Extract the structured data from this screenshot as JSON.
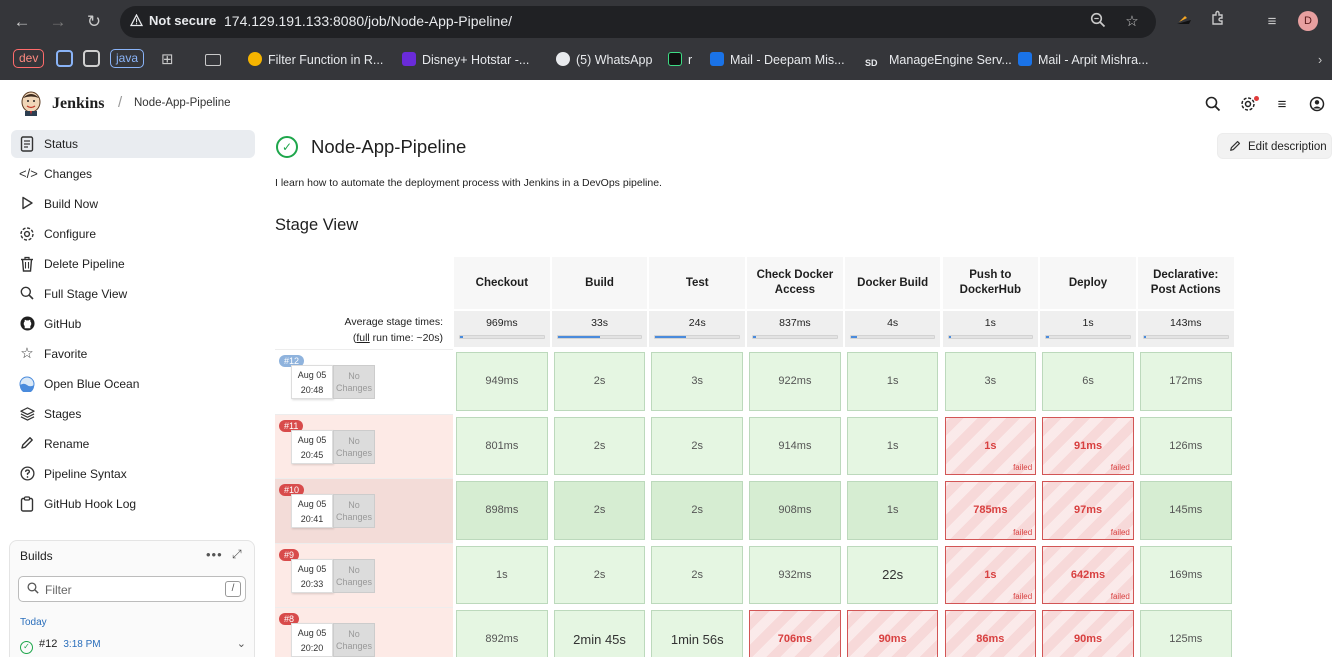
{
  "browser": {
    "security_label": "Not secure",
    "url": "174.129.191.133:8080/job/Node-App-Pipeline/",
    "profile_initial": "D",
    "bookmarks": [
      {
        "label": "dev"
      },
      {
        "label": "java"
      },
      {
        "label": "Filter Function in R..."
      },
      {
        "label": "Disney+ Hotstar -..."
      },
      {
        "label": "(5) WhatsApp"
      },
      {
        "label": "r"
      },
      {
        "label": "Mail - Deepam Mis..."
      },
      {
        "label": "ManageEngine Serv..."
      },
      {
        "label": "Mail - Arpit Mishra..."
      }
    ]
  },
  "header": {
    "app_title": "Jenkins",
    "separator": "/",
    "breadcrumb": "Node-App-Pipeline"
  },
  "sidebar": {
    "items": [
      {
        "label": "Status",
        "icon": "document-icon"
      },
      {
        "label": "Changes",
        "icon": "code-icon"
      },
      {
        "label": "Build Now",
        "icon": "play-icon"
      },
      {
        "label": "Configure",
        "icon": "gear-icon"
      },
      {
        "label": "Delete Pipeline",
        "icon": "trash-icon"
      },
      {
        "label": "Full Stage View",
        "icon": "search-icon"
      },
      {
        "label": "GitHub",
        "icon": "github-icon"
      },
      {
        "label": "Favorite",
        "icon": "star-icon"
      },
      {
        "label": "Open Blue Ocean",
        "icon": "blue-ocean-icon"
      },
      {
        "label": "Stages",
        "icon": "layers-icon"
      },
      {
        "label": "Rename",
        "icon": "pencil-icon"
      },
      {
        "label": "Pipeline Syntax",
        "icon": "help-icon"
      },
      {
        "label": "GitHub Hook Log",
        "icon": "clipboard-icon"
      }
    ],
    "builds": {
      "title": "Builds",
      "more": "•••",
      "filter_placeholder": "Filter",
      "filter_shortcut": "/",
      "group_label": "Today",
      "build_number": "#12",
      "build_time": "3:18 PM"
    }
  },
  "main": {
    "title": "Node-App-Pipeline",
    "edit_label": "Edit description",
    "description": "I learn how to automate the deployment process with Jenkins in a DevOps pipeline.",
    "stage_view_title": "Stage View",
    "avg_label": "Average stage times:",
    "full_prefix": "(",
    "full_link": "full",
    "full_suffix": " run time: ~20s)",
    "stages": [
      "Checkout",
      "Build",
      "Test",
      "Check Docker\nAccess",
      "Docker Build",
      "Push to\nDockerHub",
      "Deploy",
      "Declarative:\nPost Actions"
    ],
    "averages": [
      {
        "label": "969ms",
        "fill": 0.03
      },
      {
        "label": "33s",
        "fill": 0.5
      },
      {
        "label": "24s",
        "fill": 0.37
      },
      {
        "label": "837ms",
        "fill": 0.03
      },
      {
        "label": "4s",
        "fill": 0.08
      },
      {
        "label": "1s",
        "fill": 0.03
      },
      {
        "label": "1s",
        "fill": 0.03
      },
      {
        "label": "143ms",
        "fill": 0.01
      }
    ],
    "failed_label": "failed",
    "no_changes": "No\nChanges",
    "runs": [
      {
        "number": "#12",
        "status": "success",
        "date": "Aug 05",
        "time": "20:48",
        "cells": [
          [
            "949ms",
            "ok"
          ],
          [
            "2s",
            "ok"
          ],
          [
            "3s",
            "ok"
          ],
          [
            "922ms",
            "ok"
          ],
          [
            "1s",
            "ok"
          ],
          [
            "3s",
            "ok"
          ],
          [
            "6s",
            "ok"
          ],
          [
            "172ms",
            "ok"
          ]
        ]
      },
      {
        "number": "#11",
        "status": "failed",
        "date": "Aug 05",
        "time": "20:45",
        "cells": [
          [
            "801ms",
            "ok"
          ],
          [
            "2s",
            "ok"
          ],
          [
            "2s",
            "ok"
          ],
          [
            "914ms",
            "ok"
          ],
          [
            "1s",
            "ok"
          ],
          [
            "1s",
            "fail"
          ],
          [
            "91ms",
            "fail"
          ],
          [
            "126ms",
            "ok"
          ]
        ]
      },
      {
        "number": "#10",
        "status": "failed",
        "date": "Aug 05",
        "time": "20:41",
        "cells": [
          [
            "898ms",
            "ok"
          ],
          [
            "2s",
            "ok"
          ],
          [
            "2s",
            "ok"
          ],
          [
            "908ms",
            "ok"
          ],
          [
            "1s",
            "ok"
          ],
          [
            "785ms",
            "fail"
          ],
          [
            "97ms",
            "fail"
          ],
          [
            "145ms",
            "ok"
          ]
        ]
      },
      {
        "number": "#9",
        "status": "failed",
        "date": "Aug 05",
        "time": "20:33",
        "cells": [
          [
            "1s",
            "ok"
          ],
          [
            "2s",
            "ok"
          ],
          [
            "2s",
            "ok"
          ],
          [
            "932ms",
            "ok"
          ],
          [
            "22s",
            "ok"
          ],
          [
            "1s",
            "fail"
          ],
          [
            "642ms",
            "fail"
          ],
          [
            "169ms",
            "ok"
          ]
        ]
      },
      {
        "number": "#8",
        "status": "failed",
        "date": "Aug 05",
        "time": "20:20",
        "cells": [
          [
            "892ms",
            "ok"
          ],
          [
            "2min 45s",
            "ok"
          ],
          [
            "1min 56s",
            "ok"
          ],
          [
            "706ms",
            "fail"
          ],
          [
            "90ms",
            "fail"
          ],
          [
            "86ms",
            "fail"
          ],
          [
            "90ms",
            "fail"
          ],
          [
            "125ms",
            "ok"
          ]
        ]
      }
    ]
  },
  "colors": {
    "success_green": "#1ea64b",
    "fail_red": "#d84040",
    "row_fail_bg": "#fdeae6",
    "row_fail_hover_bg": "#f3dcd8",
    "cell_ok": "#e5f6e2",
    "bar_blue": "#4a8bdc"
  }
}
